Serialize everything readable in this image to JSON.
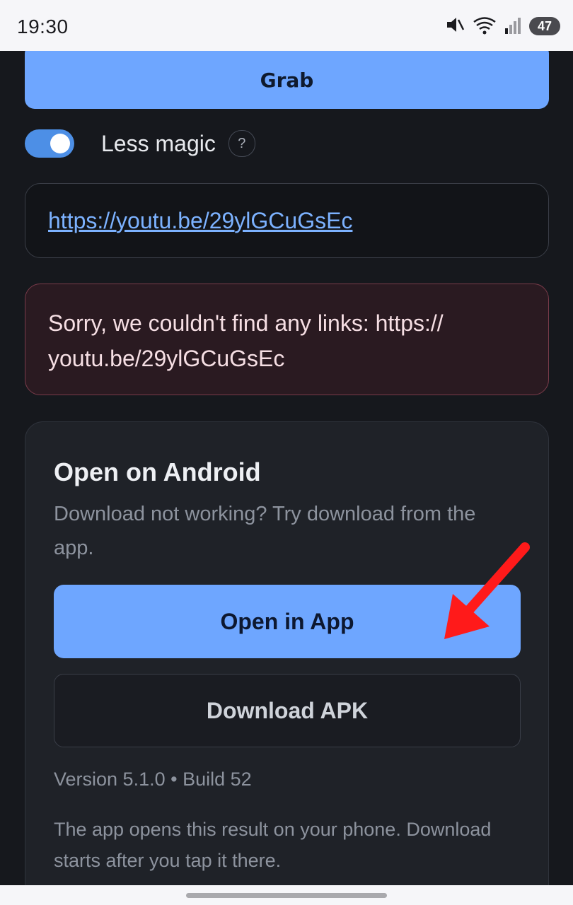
{
  "status_bar": {
    "time": "19:30",
    "battery": "47",
    "icons": [
      "mute-icon",
      "wifi-icon",
      "signal-icon",
      "battery-icon"
    ]
  },
  "main": {
    "grab_button_label": "Grab",
    "toggle": {
      "label": "Less magic",
      "on": true,
      "help": "?"
    },
    "url": "https://youtu.be/29ylGCuGsEc",
    "error_message": "Sorry, we couldn't find any links: https://\nyoutu.be/29ylGCuGsEc"
  },
  "android_card": {
    "title": "Open on Android",
    "description": "Download not working? Try download from the app.",
    "open_app_label": "Open in App",
    "download_apk_label": "Download APK",
    "version": "Version 5.1.0 • Build 52",
    "footnote": "The app opens this result on your phone. Download starts after you tap it there."
  },
  "colors": {
    "accent": "#6ea6ff",
    "background": "#16181d",
    "error_background": "#2a1a21",
    "annotation": "#ff1a1a"
  }
}
